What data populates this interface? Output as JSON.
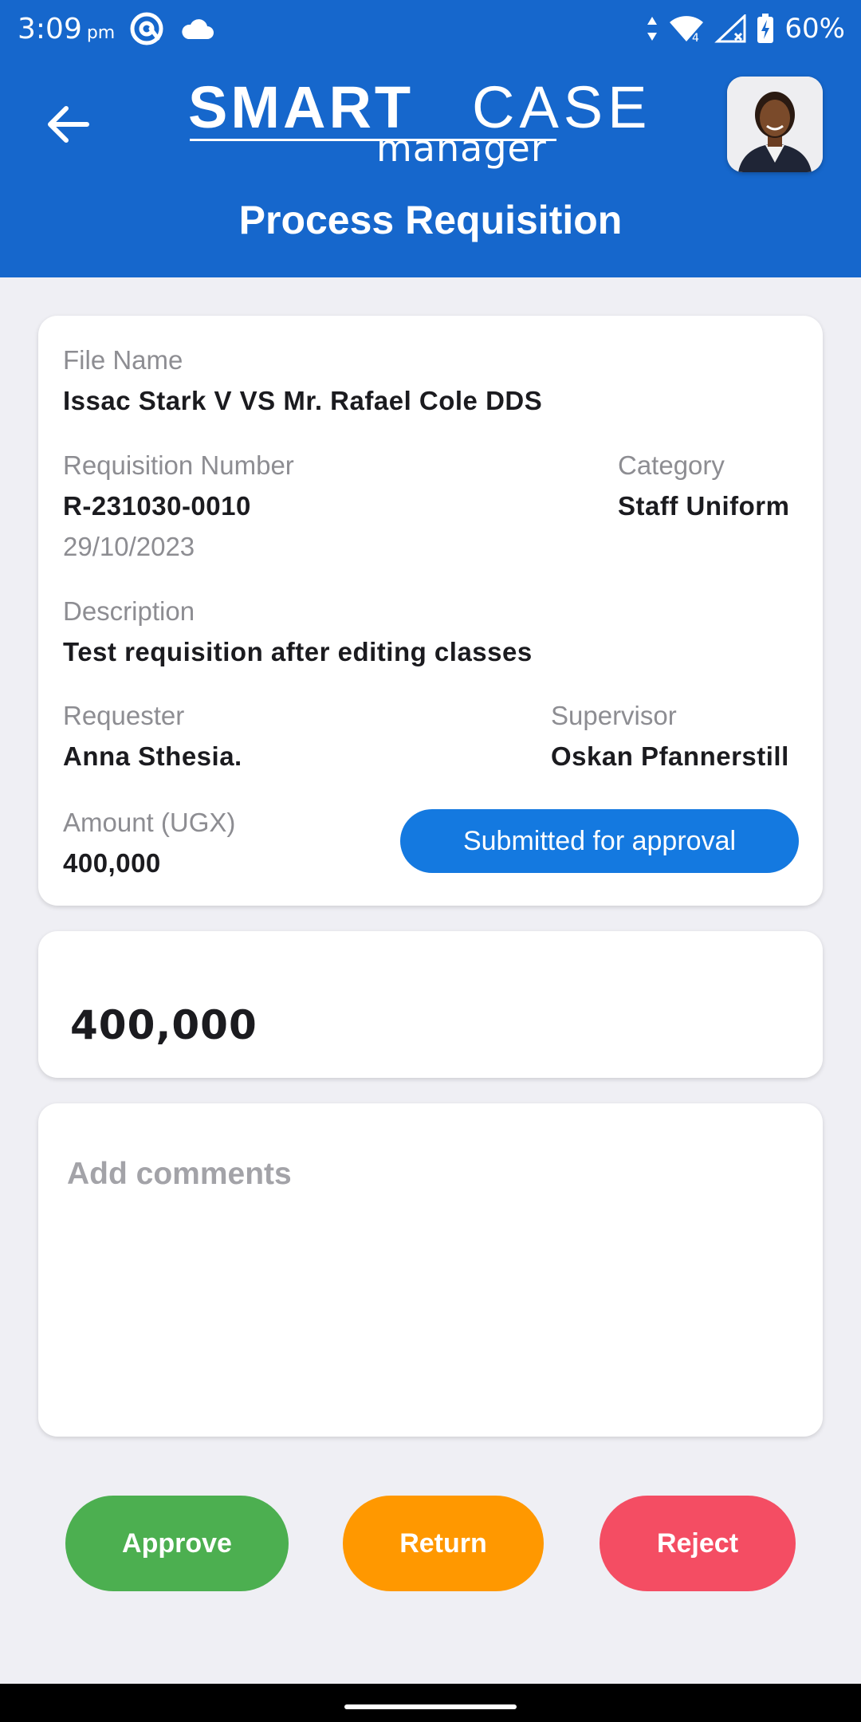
{
  "status_bar": {
    "time": "3:09",
    "ampm": "pm",
    "battery": "60%"
  },
  "header": {
    "logo_word1": "SMART",
    "logo_word2": "CASE",
    "logo_sub": "manager",
    "title": "Process Requisition"
  },
  "details": {
    "file_name_label": "File Name",
    "file_name": "Issac Stark V VS Mr. Rafael Cole DDS",
    "req_number_label": "Requisition Number",
    "req_number": "R-231030-0010",
    "req_date": "29/10/2023",
    "category_label": "Category",
    "category": "Staff Uniform",
    "description_label": "Description",
    "description": "Test requisition after editing classes",
    "requester_label": "Requester",
    "requester": "Anna Sthesia.",
    "supervisor_label": "Supervisor",
    "supervisor": "Oskan Pfannerstill",
    "amount_label": "Amount (UGX)",
    "amount": "400,000",
    "status": "Submitted for approval"
  },
  "amount_field": {
    "value": "400,000"
  },
  "comments": {
    "placeholder": "Add comments"
  },
  "actions": {
    "approve": "Approve",
    "return": "Return",
    "reject": "Reject"
  },
  "colors": {
    "header_bg": "#1667cc",
    "status_pill": "#1479e0",
    "approve": "#4caf50",
    "return": "#ff9800",
    "reject": "#f44d63"
  }
}
